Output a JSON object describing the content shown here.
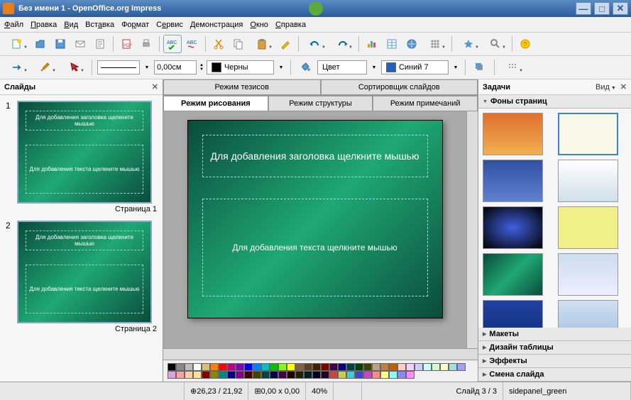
{
  "window": {
    "title": "Без имени 1 - OpenOffice.org Impress"
  },
  "menu": [
    "Файл",
    "Правка",
    "Вид",
    "Вставка",
    "Формат",
    "Сервис",
    "Демонстрация",
    "Окно",
    "Справка"
  ],
  "toolbar2": {
    "width": "0,00см",
    "linecolor_label": "Черны",
    "fill_label": "Цвет",
    "fillcolor_label": "Синий 7"
  },
  "panels": {
    "slides_title": "Слайды",
    "tasks_title": "Задачи",
    "view_label": "Вид",
    "backgrounds": "Фоны страниц",
    "layouts": "Макеты",
    "table_design": "Дизайн таблицы",
    "effects": "Эффекты",
    "transition": "Смена слайда"
  },
  "slides": [
    {
      "num": "1",
      "caption": "Страница 1"
    },
    {
      "num": "2",
      "caption": "Страница 2"
    }
  ],
  "slide_placeholder": {
    "title": "Для добавления заголовка щелкните мышью",
    "body": "Для добавления текста щелкните мышью"
  },
  "tabs": {
    "outline_top": "Режим тезисов",
    "sorter_top": "Сортировщик слайдов",
    "draw": "Режим рисования",
    "structure": "Режим структуры",
    "notes": "Режим примечаний"
  },
  "status": {
    "coords": "26,23 / 21,92",
    "size": "0,00 x 0,00",
    "zoom": "40%",
    "slide": "Слайд 3 / 3",
    "template": "sidepanel_green"
  },
  "color_row1": [
    "#000",
    "#888",
    "#bbb",
    "#fff",
    "#d8c070",
    "#ff8000",
    "#ff0000",
    "#c00080",
    "#8000c0",
    "#0000ff",
    "#0080ff",
    "#00c0c0",
    "#00c000",
    "#80ff00",
    "#ffff00",
    "#806040",
    "#604020",
    "#402000",
    "#800000",
    "#400040",
    "#000080",
    "#004040",
    "#004000",
    "#404000",
    "#c0a080",
    "#c08040",
    "#c06000",
    "#ffcccc",
    "#ffccff",
    "#ccccff",
    "#ccffff",
    "#ccffcc"
  ],
  "color_row2": [
    "#ffffcc",
    "#a0e0e0",
    "#a0a0ff",
    "#e0a0e0",
    "#ffa0a0",
    "#ffd0a0",
    "#ffe0a0",
    "#800",
    "#880",
    "#088",
    "#008",
    "#808",
    "#400",
    "#440",
    "#044",
    "#004",
    "#404",
    "#200",
    "#220",
    "#022",
    "#002",
    "#202",
    "#c44",
    "#cc4",
    "#4cc",
    "#44c",
    "#c4c",
    "#f88",
    "#ff8",
    "#8ff",
    "#88f",
    "#f8f"
  ],
  "bg_templates": [
    {
      "bg": "linear-gradient(#e07030,#f0b050)"
    },
    {
      "bg": "#f8f8e8",
      "sel": true
    },
    {
      "bg": "linear-gradient(#3050a0,#6080d0)"
    },
    {
      "bg": "linear-gradient(#fff,#d0e0e8)"
    },
    {
      "bg": "radial-gradient(#4060e0,#000)"
    },
    {
      "bg": "#f0f088"
    },
    {
      "bg": "linear-gradient(135deg,#0a4b3a,#1fa875,#0a4b3a)"
    },
    {
      "bg": "linear-gradient(#cde,#eef)"
    },
    {
      "bg": "linear-gradient(#2040a0,#103080)"
    },
    {
      "bg": "linear-gradient(#d0e0f0,#a0c0e0)"
    }
  ]
}
